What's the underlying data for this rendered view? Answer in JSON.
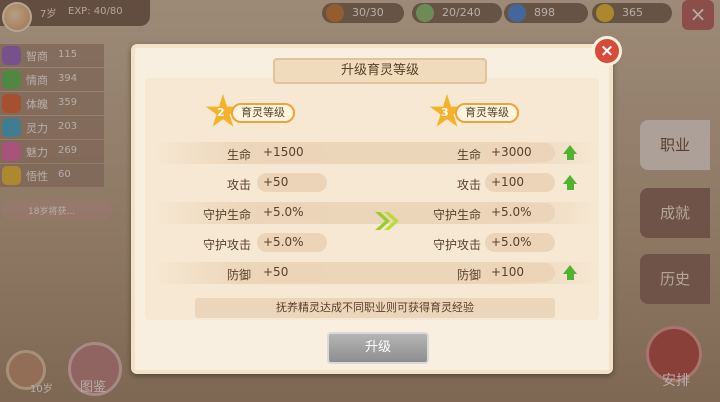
{
  "profile": {
    "age": "7岁",
    "exp": "EXP: 40/80"
  },
  "stats": [
    {
      "name": "智商",
      "value": "115",
      "color": "#9a6bd0"
    },
    {
      "name": "情商",
      "value": "394",
      "color": "#5fc25a"
    },
    {
      "name": "体魄",
      "value": "359",
      "color": "#e86a3a"
    },
    {
      "name": "灵力",
      "value": "203",
      "color": "#3fb3d7"
    },
    {
      "name": "魅力",
      "value": "269",
      "color": "#e96fb3"
    },
    {
      "name": "悟性",
      "value": "60",
      "color": "#f0c33a"
    }
  ],
  "left_tip": "18岁将获...",
  "resources": [
    {
      "icon": "energy-icon",
      "text": "30/30",
      "color": "#c87f3c"
    },
    {
      "icon": "food-icon",
      "text": "20/240",
      "color": "#8bc87a"
    },
    {
      "icon": "lightning-icon",
      "text": "898",
      "color": "#4a8ee8"
    },
    {
      "icon": "smile-icon",
      "text": "365",
      "color": "#f3c23a"
    }
  ],
  "right_tabs": [
    "职业",
    "成就",
    "历史"
  ],
  "bottom": {
    "age": "10岁",
    "atlas": "图鉴",
    "arrange": "安排"
  },
  "dialog": {
    "title": "升级育灵等级",
    "close": "×",
    "from_level": "2",
    "to_level": "3",
    "level_label": "育灵等级",
    "rows": [
      {
        "label": "生命",
        "from": "+1500",
        "to": "+3000",
        "up": true
      },
      {
        "label": "攻击",
        "from": "+50",
        "to": "+100",
        "up": true
      },
      {
        "label": "守护生命",
        "from": "+5.0%",
        "to": "+5.0%",
        "up": false
      },
      {
        "label": "守护攻击",
        "from": "+5.0%",
        "to": "+5.0%",
        "up": false
      },
      {
        "label": "防御",
        "from": "+50",
        "to": "+100",
        "up": true
      }
    ],
    "hint": "抚养精灵达成不同职业则可获得育灵经验",
    "button": "升级"
  }
}
